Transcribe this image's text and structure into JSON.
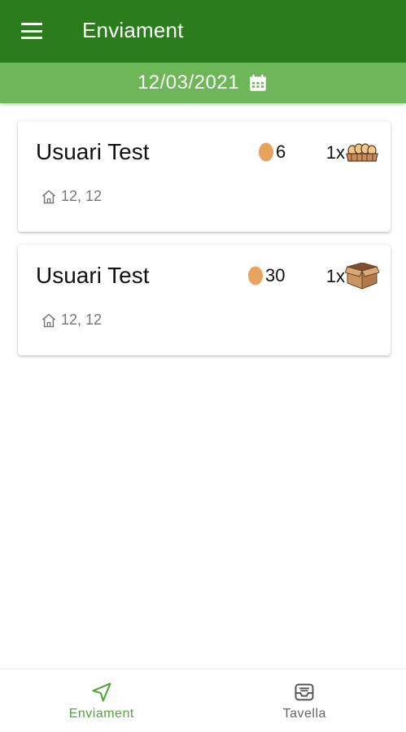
{
  "app_bar": {
    "title": "Enviament",
    "menu_icon": "hamburger-menu-icon"
  },
  "date_bar": {
    "date": "12/03/2021",
    "icon": "calendar-icon"
  },
  "deliveries": [
    {
      "name": "Usuari Test",
      "egg_count": "6",
      "pack_qty": "1x",
      "pack_icon": "egg-carton-icon",
      "address": "12, 12"
    },
    {
      "name": "Usuari Test",
      "egg_count": "30",
      "pack_qty": "1x",
      "pack_icon": "cardboard-box-icon",
      "address": "12, 12"
    }
  ],
  "bottom_nav": {
    "items": [
      {
        "label": "Enviament",
        "icon": "navigation-arrow-icon",
        "active": true
      },
      {
        "label": "Tavella",
        "icon": "inbox-tray-icon",
        "active": false
      }
    ]
  },
  "colors": {
    "app_bar": "#2a7c1c",
    "date_bar": "#6db758",
    "egg": "#e8a35c",
    "active_nav": "#4fa83a"
  }
}
